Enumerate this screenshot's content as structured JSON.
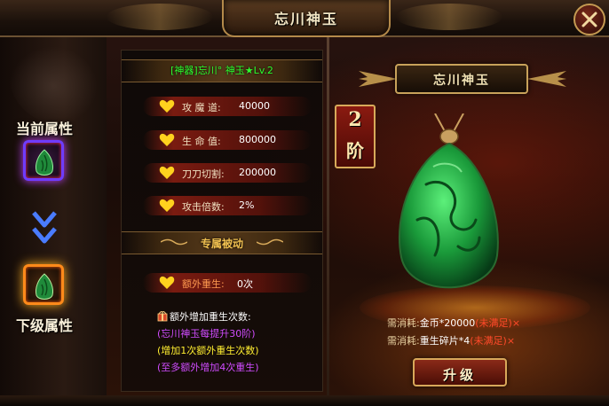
{
  "window": {
    "title": "忘川神玉",
    "close_icon": "close-x-icon"
  },
  "left_panel": {
    "current_label": "当前属性",
    "next_label": "下级属性",
    "current_slot_icon": "jade-pendant-icon",
    "next_slot_icon": "jade-pendant-icon",
    "arrow_icon": "double-chevron-down-icon",
    "current_glow_color": "#c040ff",
    "next_glow_color": "#ffb020"
  },
  "stats_panel": {
    "item_name": "[神器]忘川° 神玉★Lv.2",
    "item_name_color": "#2eff2e",
    "stats": [
      {
        "label": "攻 魔 道:",
        "value": "40000"
      },
      {
        "label": "生 命 值:",
        "value": "800000"
      },
      {
        "label": "刀刀切割:",
        "value": "200000"
      },
      {
        "label": "攻击倍数:",
        "value": "2%"
      }
    ],
    "passive_title": "专属被动",
    "passive": {
      "label": "额外重生:",
      "value": "0次"
    },
    "bonus_title": "额外增加重生次数:",
    "bonus_lines": [
      "(忘川神玉每提升30阶)",
      "(增加1次额外重生次数)",
      "(至多额外增加4次重生)"
    ]
  },
  "relic": {
    "title": "忘川神玉",
    "rank_number": "2",
    "rank_unit": "阶",
    "costs": [
      {
        "label": "需消耗:",
        "item": "金币*20000",
        "status": "(未满足)",
        "mark": "×"
      },
      {
        "label": "需消耗:",
        "item": "重生碎片*4",
        "status": "(未满足)",
        "mark": "×"
      }
    ],
    "upgrade_label": "升级"
  },
  "colors": {
    "accent_gold": "#c8a25a",
    "jade_green": "#2fbf4a",
    "warning_red": "#ff4a2a"
  }
}
